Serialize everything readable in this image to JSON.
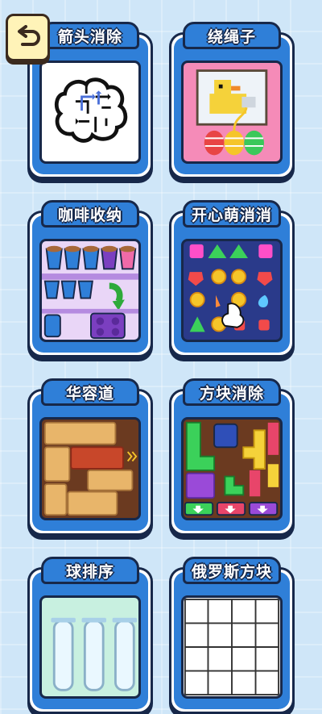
{
  "back_button": {
    "icon": "back-arrow-icon"
  },
  "games": [
    {
      "title": "箭头消除",
      "icon": "arrow-brain-icon"
    },
    {
      "title": "绕绳子",
      "icon": "pixel-duck-rope-icon"
    },
    {
      "title": "咖啡收纳",
      "icon": "coffee-cups-icon"
    },
    {
      "title": "开心萌消消",
      "icon": "gem-match-icon"
    },
    {
      "title": "华容道",
      "icon": "sliding-wood-block-icon"
    },
    {
      "title": "方块消除",
      "icon": "color-blocks-icon"
    },
    {
      "title": "球排序",
      "icon": "ball-tubes-icon"
    },
    {
      "title": "俄罗斯方块",
      "icon": "tetris-grid-icon"
    }
  ],
  "colors": {
    "card_blue": "#2f7fd8",
    "outline": "#17284a",
    "background": "#cfe6f8"
  }
}
